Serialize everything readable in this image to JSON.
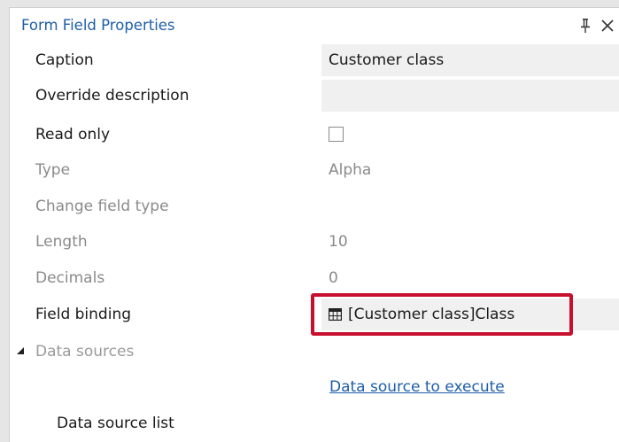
{
  "panel": {
    "title": "Form Field Properties",
    "pin_icon": "pin-icon",
    "close_icon": "close-icon"
  },
  "properties": {
    "caption": {
      "label": "Caption",
      "value": "Customer class"
    },
    "override_description": {
      "label": "Override description",
      "value": ""
    },
    "read_only": {
      "label": "Read only",
      "checked": false
    },
    "type": {
      "label": "Type",
      "value": "Alpha"
    },
    "change_field_type": {
      "label": "Change field type"
    },
    "length": {
      "label": "Length",
      "value": "10"
    },
    "decimals": {
      "label": "Decimals",
      "value": "0"
    },
    "field_binding": {
      "label": "Field binding",
      "value": "[Customer class]Class",
      "icon": "table-icon"
    }
  },
  "data_sources": {
    "section_label": "Data sources",
    "expander_icon": "collapse-triangle-icon",
    "execute_link": "Data source to execute",
    "list_label": "Data source list"
  },
  "colors": {
    "accent": "#1e5fa8",
    "highlight": "#c8102e",
    "value_background": "#f0f0f0"
  }
}
